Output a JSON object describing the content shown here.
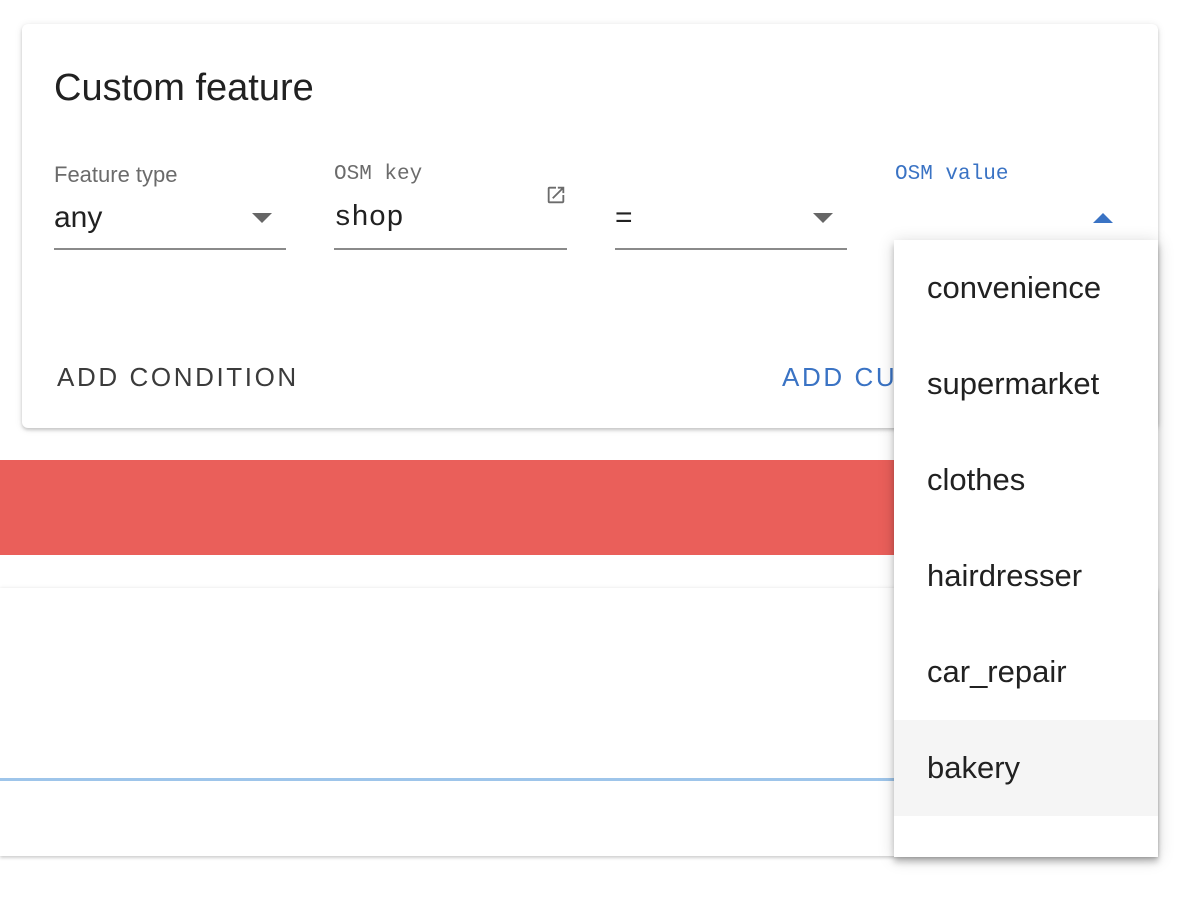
{
  "card": {
    "title": "Custom feature",
    "fields": {
      "feature_type": {
        "label": "Feature type",
        "value": "any"
      },
      "osm_key": {
        "label": "OSM key",
        "value": "shop"
      },
      "operator": {
        "value": "="
      },
      "osm_value": {
        "label": "OSM value",
        "value": ""
      }
    },
    "actions": {
      "add_condition": "ADD CONDITION",
      "add_custom": "ADD CU"
    }
  },
  "dropdown": {
    "options": [
      "convenience",
      "supermarket",
      "clothes",
      "hairdresser",
      "car_repair",
      "bakery"
    ],
    "highlighted": "bakery"
  },
  "colors": {
    "accent": "#3a73c4",
    "alert": "#ea5f5a",
    "panel_line": "#9ec5ea"
  },
  "icons": {
    "external_link": "open-in-new-icon",
    "dropdown_closed": "arrow-drop-down-icon",
    "dropdown_open": "arrow-drop-up-icon"
  }
}
